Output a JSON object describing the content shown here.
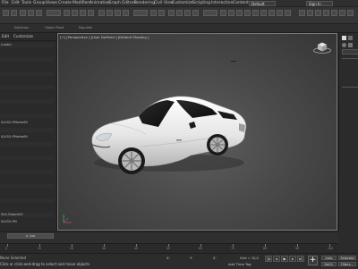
{
  "menu": [
    "File",
    "Edit",
    "Tools",
    "Group",
    "Views",
    "Create",
    "Modifiers",
    "Animation",
    "Graph Editors",
    "Rendering",
    "Civil View",
    "Customize",
    "Scripting",
    "Interactive",
    "Content"
  ],
  "workspace": "Default",
  "sign_in": "Sign In",
  "ribbon_labels": [
    "Selection",
    "Object Paint",
    "Populate"
  ],
  "scene_explorer": {
    "tabs": [
      "Edit",
      "Customize"
    ],
    "rows": [
      "(node)",
      "",
      "",
      "",
      "",
      "",
      "",
      "",
      "",
      "",
      "",
      "SLK55-PMwhe69",
      "",
      "SLK55-PMwhe69",
      "",
      "",
      "",
      "",
      "",
      "",
      "",
      "",
      "",
      "",
      "SLK-ObjectAO",
      "SLK55-PM"
    ]
  },
  "viewport": {
    "label": "[+] [Perspective ] [User Defined ] [Default Shading ]"
  },
  "timeline": {
    "frame_display": "0 / 100",
    "ticks": [
      "0",
      "10",
      "20",
      "30",
      "40",
      "50",
      "60",
      "70",
      "80",
      "90",
      "100"
    ]
  },
  "status": {
    "line1": "None Selected",
    "line2": "Click or click-and-drag to select and move objects",
    "x": "X:",
    "y": "Y:",
    "z": "Z:",
    "grid": "Grid = 10,0",
    "add_time_tag": "Add Time Tag",
    "auto": "Auto",
    "selected": "Selected",
    "set_key": "Set K.",
    "filters": "Filters..."
  },
  "colors": {
    "accent_selection": "#3d5a7a",
    "viewport_bg": "#4a4a4a"
  }
}
